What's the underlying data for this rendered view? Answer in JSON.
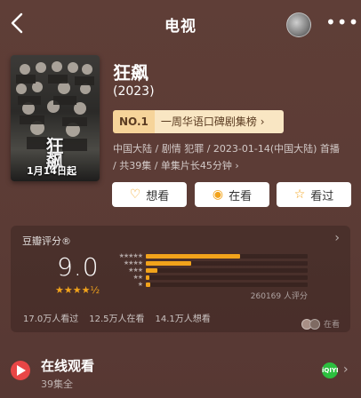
{
  "nav": {
    "title": "电视",
    "more_label": "•••"
  },
  "subject": {
    "title": "狂飙",
    "year": "(2023)",
    "poster_char": "狂飙",
    "poster_date": "1月14日起",
    "rank_no": "NO.1",
    "rank_text": "一周华语口碑剧集榜",
    "meta_line1": "中国大陆 / 剧情 犯罪 / 2023-01-14(中国大陆) 首播",
    "meta_line2": "/ 共39集 / 单集片长45分钟 ›"
  },
  "actions": [
    {
      "label": "想看",
      "icon": "heart-plus-icon",
      "glyph": "♡"
    },
    {
      "label": "在看",
      "icon": "target-icon",
      "glyph": "◉"
    },
    {
      "label": "看过",
      "icon": "star-outline-icon",
      "glyph": "☆"
    }
  ],
  "rating": {
    "label": "豆瓣评分®",
    "score": "9.0",
    "stars_filled": 4.5,
    "stars_text": "★★★★½",
    "distribution": [
      {
        "stars": "★★★★★",
        "pct": 0.58
      },
      {
        "stars": "★★★★",
        "pct": 0.28
      },
      {
        "stars": "★★★",
        "pct": 0.07
      },
      {
        "stars": "★★",
        "pct": 0.02
      },
      {
        "stars": "★",
        "pct": 0.03
      }
    ],
    "votes_text": "260169 人评分",
    "stats": [
      "17.0万人看过",
      "12.5万人在看",
      "14.1万人想看"
    ],
    "watching_text": "在看"
  },
  "online": {
    "title": "在线观看",
    "subtitle": "39集全",
    "provider_badge": "iQIYI"
  }
}
